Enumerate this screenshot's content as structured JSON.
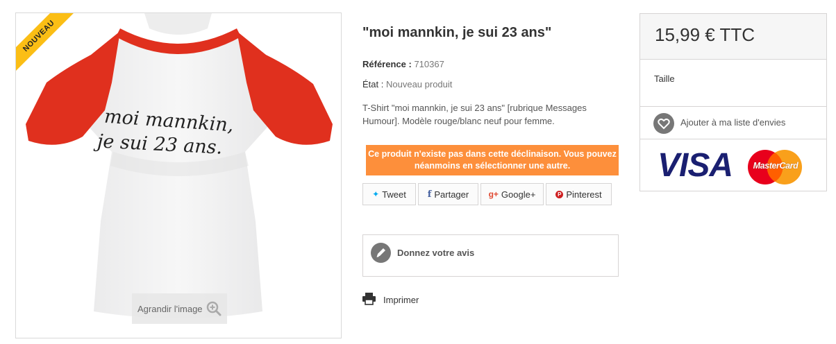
{
  "product": {
    "badge": "NOUVEAU",
    "zoom_label": "Agrandir l'image",
    "shirt_text_line1": "moi mannkin,",
    "shirt_text_line2": "je sui 23 ans.",
    "title": "\"moi mannkin, je sui 23 ans\"",
    "reference_label": "Référence :",
    "reference_value": "710367",
    "condition_label": "État :",
    "condition_value": "Nouveau produit",
    "description": "T-Shirt \"moi mannkin, je sui 23 ans\" [rubrique Messages Humour]. Modèle rouge/blanc neuf pour femme.",
    "alert": "Ce produit n'existe pas dans cette déclinaison. Vous pouvez néanmoins en sélectionner une autre."
  },
  "social": {
    "tweet": "Tweet",
    "share": "Partager",
    "google": "Google+",
    "pinterest": "Pinterest",
    "tweet_icon": "twitter-bird",
    "share_icon": "f",
    "google_icon": "g+",
    "pinterest_icon": "P"
  },
  "review": {
    "label": "Donnez votre avis"
  },
  "print": {
    "label": "Imprimer"
  },
  "buy_box": {
    "price": "15,99 € TTC",
    "size_label": "Taille",
    "wishlist_label": "Ajouter à ma liste d'envies",
    "visa_text": "VISA",
    "mastercard_text": "MasterCard"
  },
  "colors": {
    "ribbon": "#fbbe15",
    "alert": "#fd8f3b",
    "sleeve_red": "#e0301e",
    "visa_blue": "#1a1f71",
    "mc_red": "#e8001c",
    "mc_orange": "#f9a01b"
  }
}
